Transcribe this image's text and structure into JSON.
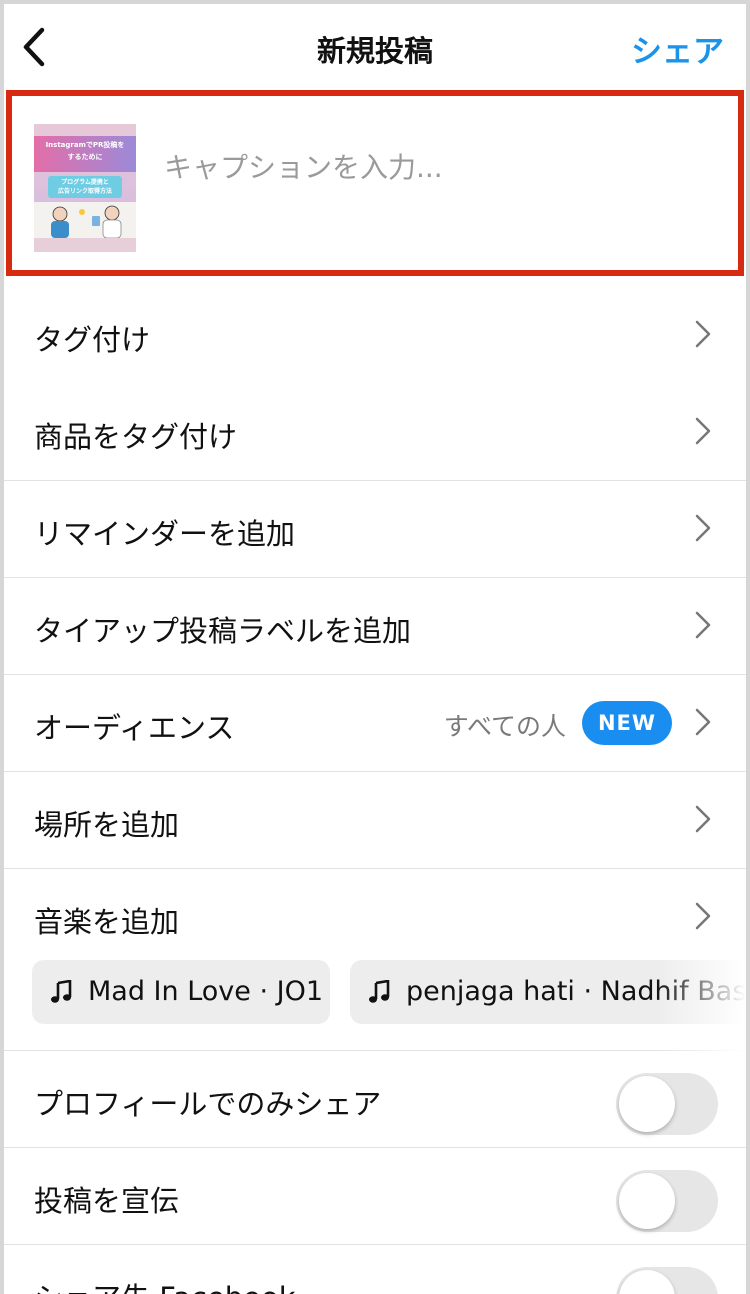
{
  "header": {
    "title": "新規投稿",
    "share_label": "シェア",
    "accent_color": "#1a94ea"
  },
  "caption": {
    "placeholder": "キャプションを入力...",
    "thumbnail": {
      "line1": "InstagramでPR投稿を",
      "line2": "するために",
      "box_line1": "プログラム提携と",
      "box_line2": "広告リンク取得方法"
    },
    "highlight_color": "#d72a10"
  },
  "rows": {
    "tag": "タグ付け",
    "product_tag": "商品をタグ付け",
    "reminder": "リマインダーを追加",
    "tieup": "タイアップ投稿ラベルを追加",
    "audience": "オーディエンス",
    "audience_value": "すべての人",
    "audience_badge": "NEW",
    "location": "場所を追加",
    "music": "音楽を追加",
    "profile_only": "プロフィールでのみシェア",
    "promote": "投稿を宣伝",
    "share_facebook": "シェア先 Facebook"
  },
  "music_suggestions": [
    {
      "label": "Mad In Love · JO1",
      "icon": "music-note-icon"
    },
    {
      "label": "penjaga hati · Nadhif Basalamah",
      "icon": "music-note-icon"
    }
  ],
  "toggles": {
    "profile_only": false,
    "promote": false,
    "share_facebook": false
  }
}
